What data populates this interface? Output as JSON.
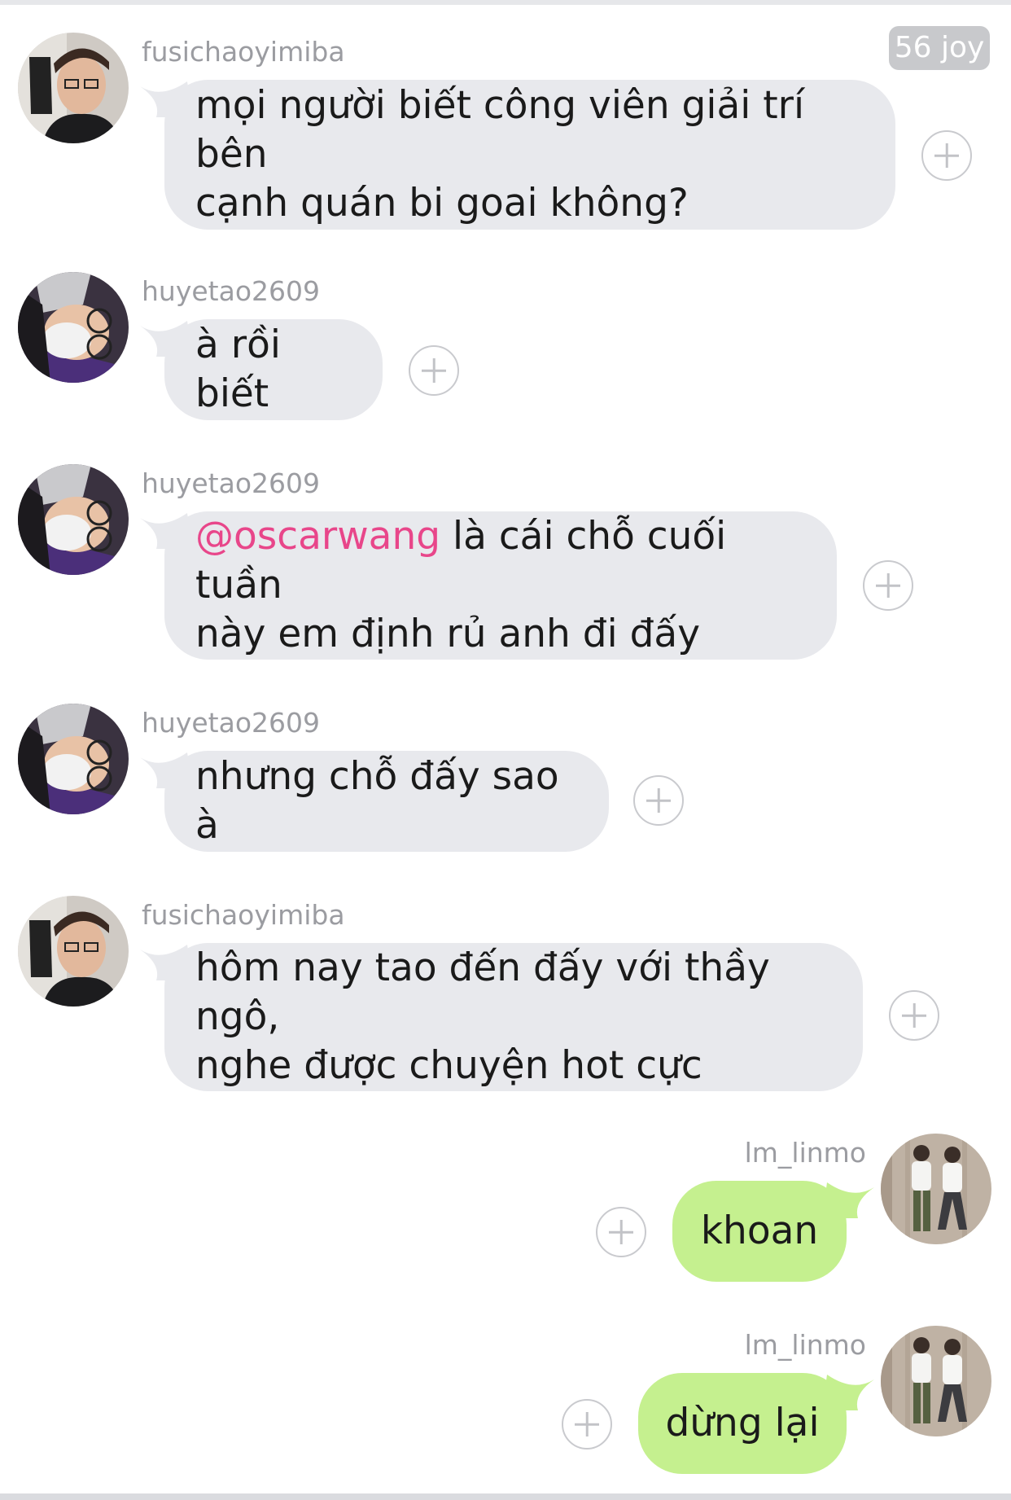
{
  "top_badge": "56 joy",
  "messages": [
    {
      "user": "fusichaoyimiba",
      "text": "mọi người biết công viên giải trí bên\ncạnh quán bi goai không?",
      "side": "in"
    },
    {
      "user": "huyetao2609",
      "text": "à rồi biết",
      "side": "in"
    },
    {
      "user": "huyetao2609",
      "mention": "@oscarwang",
      "text": " là cái chỗ cuối tuần\nnày em định rủ anh đi đấy",
      "side": "in"
    },
    {
      "user": "huyetao2609",
      "text": "nhưng chỗ đấy sao à",
      "side": "in"
    },
    {
      "user": "fusichaoyimiba",
      "text": "hôm nay tao đến đấy với thầy ngô,\nnghe được chuyện hot cực",
      "side": "in"
    },
    {
      "user": "lm_linmo",
      "text": "khoan",
      "side": "out"
    },
    {
      "user": "lm_linmo",
      "text": "dừng lại",
      "side": "out"
    }
  ],
  "icons": {
    "react_button": "plus-circle-icon",
    "avatar_fusichaoyimiba": "user-photo-glasses-icon",
    "avatar_huyetao2609": "user-photo-mask-icon",
    "avatar_lm_linmo": "user-photo-two-people-icon"
  },
  "colors": {
    "incoming_bubble": "#e8e9ed",
    "outgoing_bubble": "#c5f08f",
    "mention": "#e8468a",
    "username": "#9b9ca1",
    "badge": "#c8c9cc"
  }
}
